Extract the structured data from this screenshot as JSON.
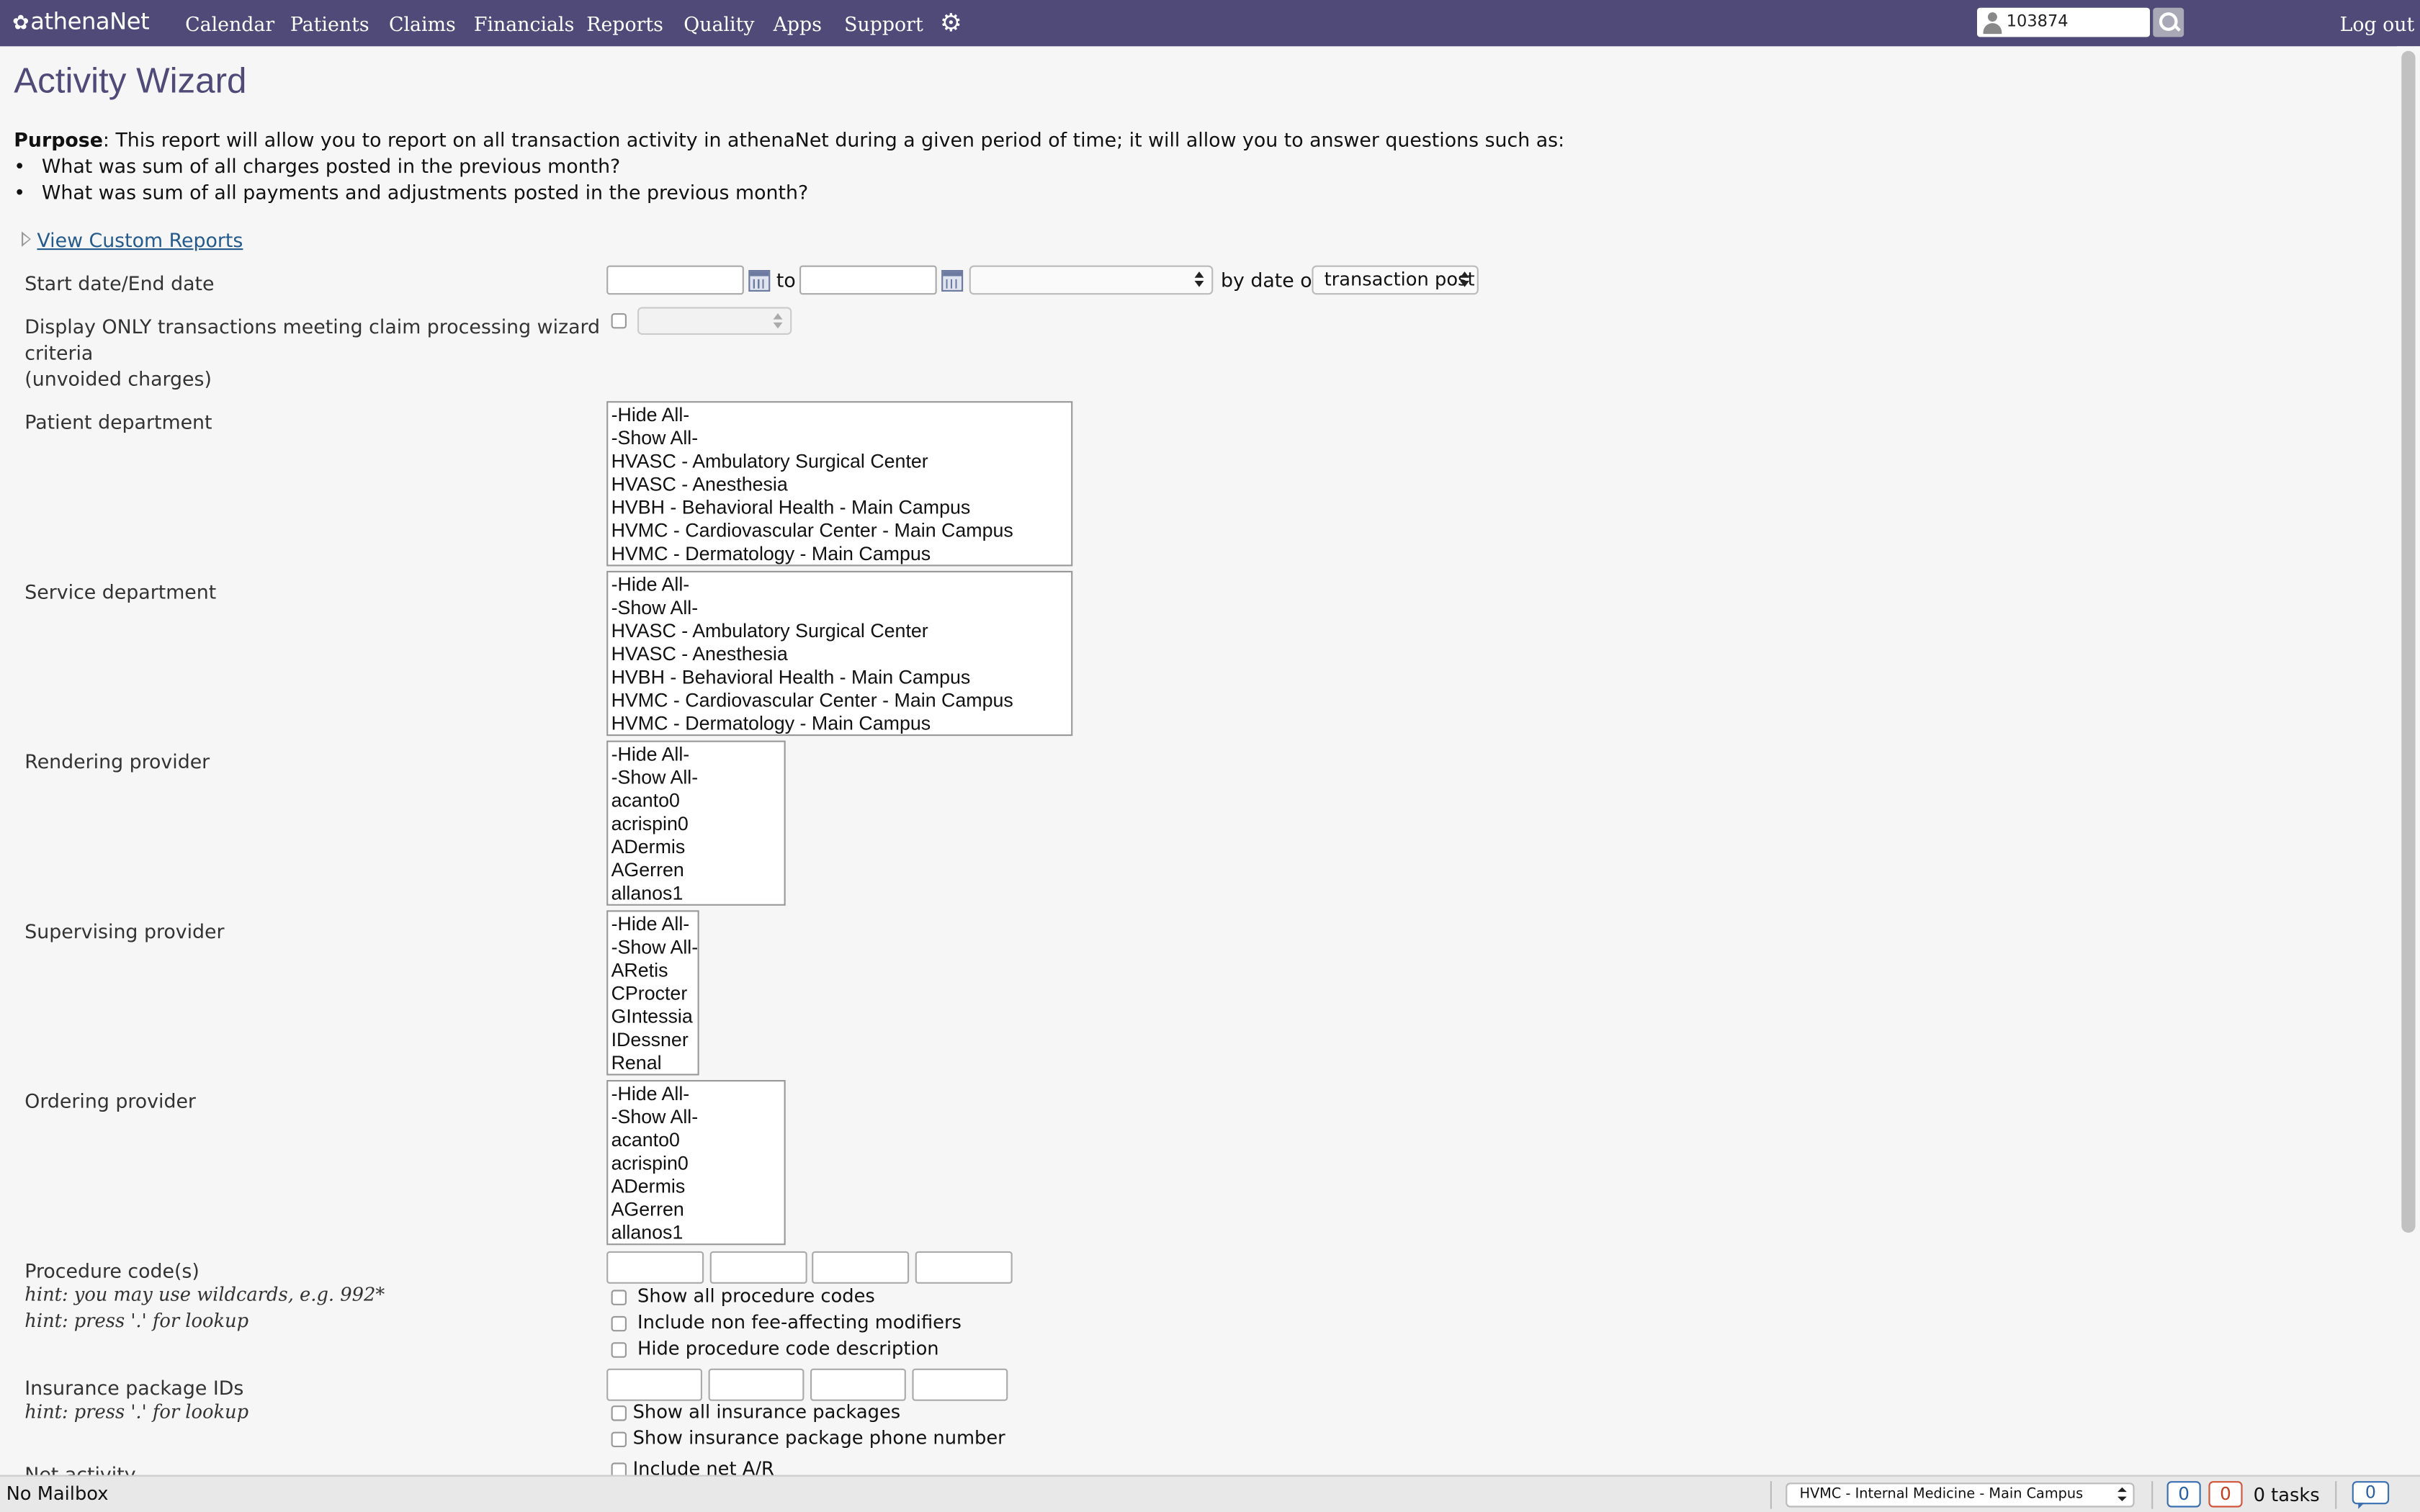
{
  "nav": {
    "logo": "athenaNet",
    "items": [
      "Calendar",
      "Patients",
      "Claims",
      "Financials",
      "Reports",
      "Quality",
      "Apps",
      "Support"
    ],
    "user_id": "103874",
    "logout": "Log out"
  },
  "page": {
    "title": "Activity Wizard",
    "purpose_label": "Purpose",
    "purpose_text": ": This report will allow you to report on all transaction activity in athenaNet during a given period of time; it will allow you to answer questions such as:",
    "bullets": [
      "What was sum of all charges posted in the previous month?",
      "What was sum of all payments and adjustments posted in the previous month?"
    ],
    "custom_reports_link": "View Custom Reports"
  },
  "form": {
    "date_label": "Start date/End date",
    "to_text": "to",
    "by_date_of": "by date of",
    "date_type_value": "transaction post",
    "claim_wizard_label_1": "Display ONLY transactions meeting claim processing wizard",
    "claim_wizard_label_2": "criteria",
    "claim_wizard_label_3": "(unvoided charges)",
    "patient_department_label": "Patient department",
    "service_department_label": "Service department",
    "rendering_provider_label": "Rendering provider",
    "supervising_provider_label": "Supervising provider",
    "ordering_provider_label": "Ordering provider",
    "department_options": [
      "-Hide All-",
      "-Show All-",
      "HVASC - Ambulatory Surgical Center",
      "HVASC - Anesthesia",
      "HVBH - Behavioral Health - Main Campus",
      "HVMC - Cardiovascular Center - Main Campus",
      "HVMC - Dermatology - Main Campus"
    ],
    "rendering_options": [
      "-Hide All-",
      "-Show All-",
      "acanto0",
      "acrispin0",
      "ADermis",
      "AGerren",
      "allanos1"
    ],
    "supervising_options": [
      "-Hide All-",
      "-Show All-",
      "ARetis",
      "CProcter",
      "GIntessia",
      "IDessner",
      "Renal"
    ],
    "ordering_options": [
      "-Hide All-",
      "-Show All-",
      "acanto0",
      "acrispin0",
      "ADermis",
      "AGerren",
      "allanos1"
    ],
    "procedure_label": "Procedure code(s)",
    "procedure_hint_1": "hint: you may use wildcards, e.g. 992*",
    "procedure_hint_2": "hint: press '.' for lookup",
    "show_all_procedure": "Show all procedure codes",
    "include_non_fee": "Include non fee-affecting modifiers",
    "hide_procedure_desc": "Hide procedure code description",
    "insurance_label": "Insurance package IDs",
    "insurance_hint": "hint: press '.' for lookup",
    "show_all_insurance": "Show all insurance packages",
    "show_insurance_phone": "Show insurance package phone number",
    "net_activity_label": "Net activity",
    "include_net_ar": "Include net A/R"
  },
  "footer": {
    "mailbox": "No Mailbox",
    "department": "HVMC - Internal Medicine - Main Campus",
    "count_blue": "0",
    "count_red": "0",
    "tasks": "0 tasks",
    "messages": "0"
  },
  "colors": {
    "nav_bg": "#4f4a77",
    "title": "#4f4a77",
    "link": "#245a8c"
  },
  "icons": [
    "leaf-logo-icon",
    "gear-icon",
    "user-icon",
    "search-icon",
    "calendar-icon",
    "chat-icon"
  ]
}
